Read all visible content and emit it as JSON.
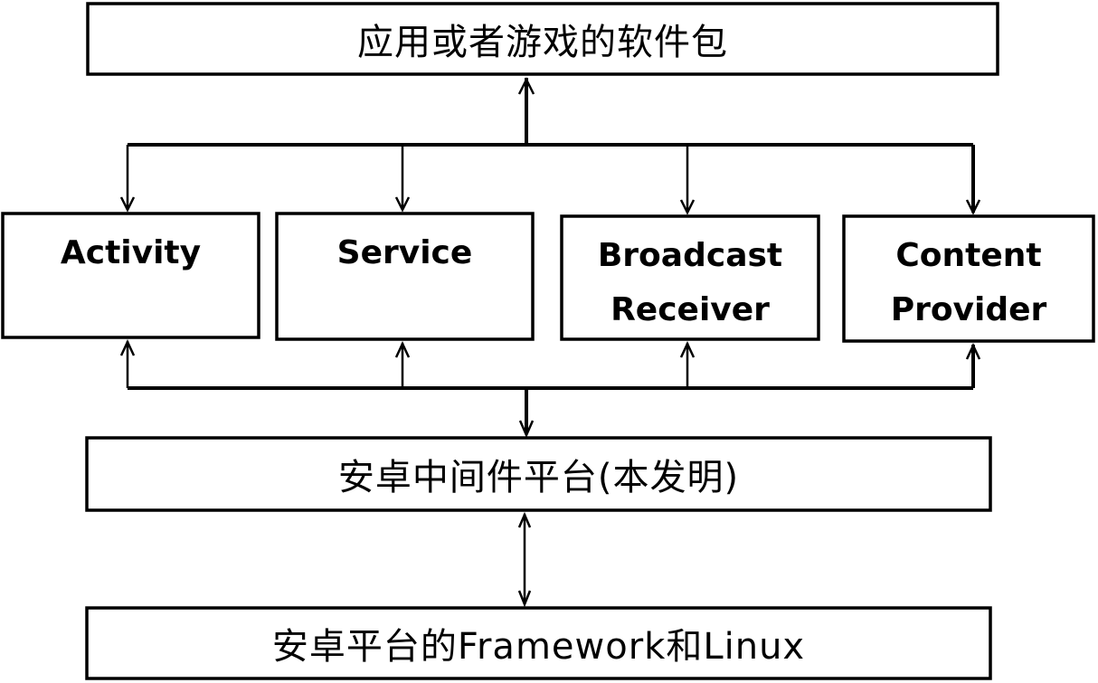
{
  "diagram": {
    "top_box": {
      "label": "应用或者游戏的软件包"
    },
    "components": [
      {
        "label_line1": "Activity",
        "label_line2": ""
      },
      {
        "label_line1": "Service",
        "label_line2": ""
      },
      {
        "label_line1": "Broadcast",
        "label_line2": "Receiver"
      },
      {
        "label_line1": "Content",
        "label_line2": "Provider"
      }
    ],
    "middleware_box": {
      "label": "安卓中间件平台(本发明)"
    },
    "bottom_box": {
      "label": "安卓平台的Framework和Linux"
    },
    "connections": [
      {
        "from": "top_box",
        "to": "components",
        "direction": "bidirectional"
      },
      {
        "from": "components",
        "to": "middleware_box",
        "direction": "bidirectional"
      },
      {
        "from": "middleware_box",
        "to": "bottom_box",
        "direction": "bidirectional"
      }
    ]
  }
}
